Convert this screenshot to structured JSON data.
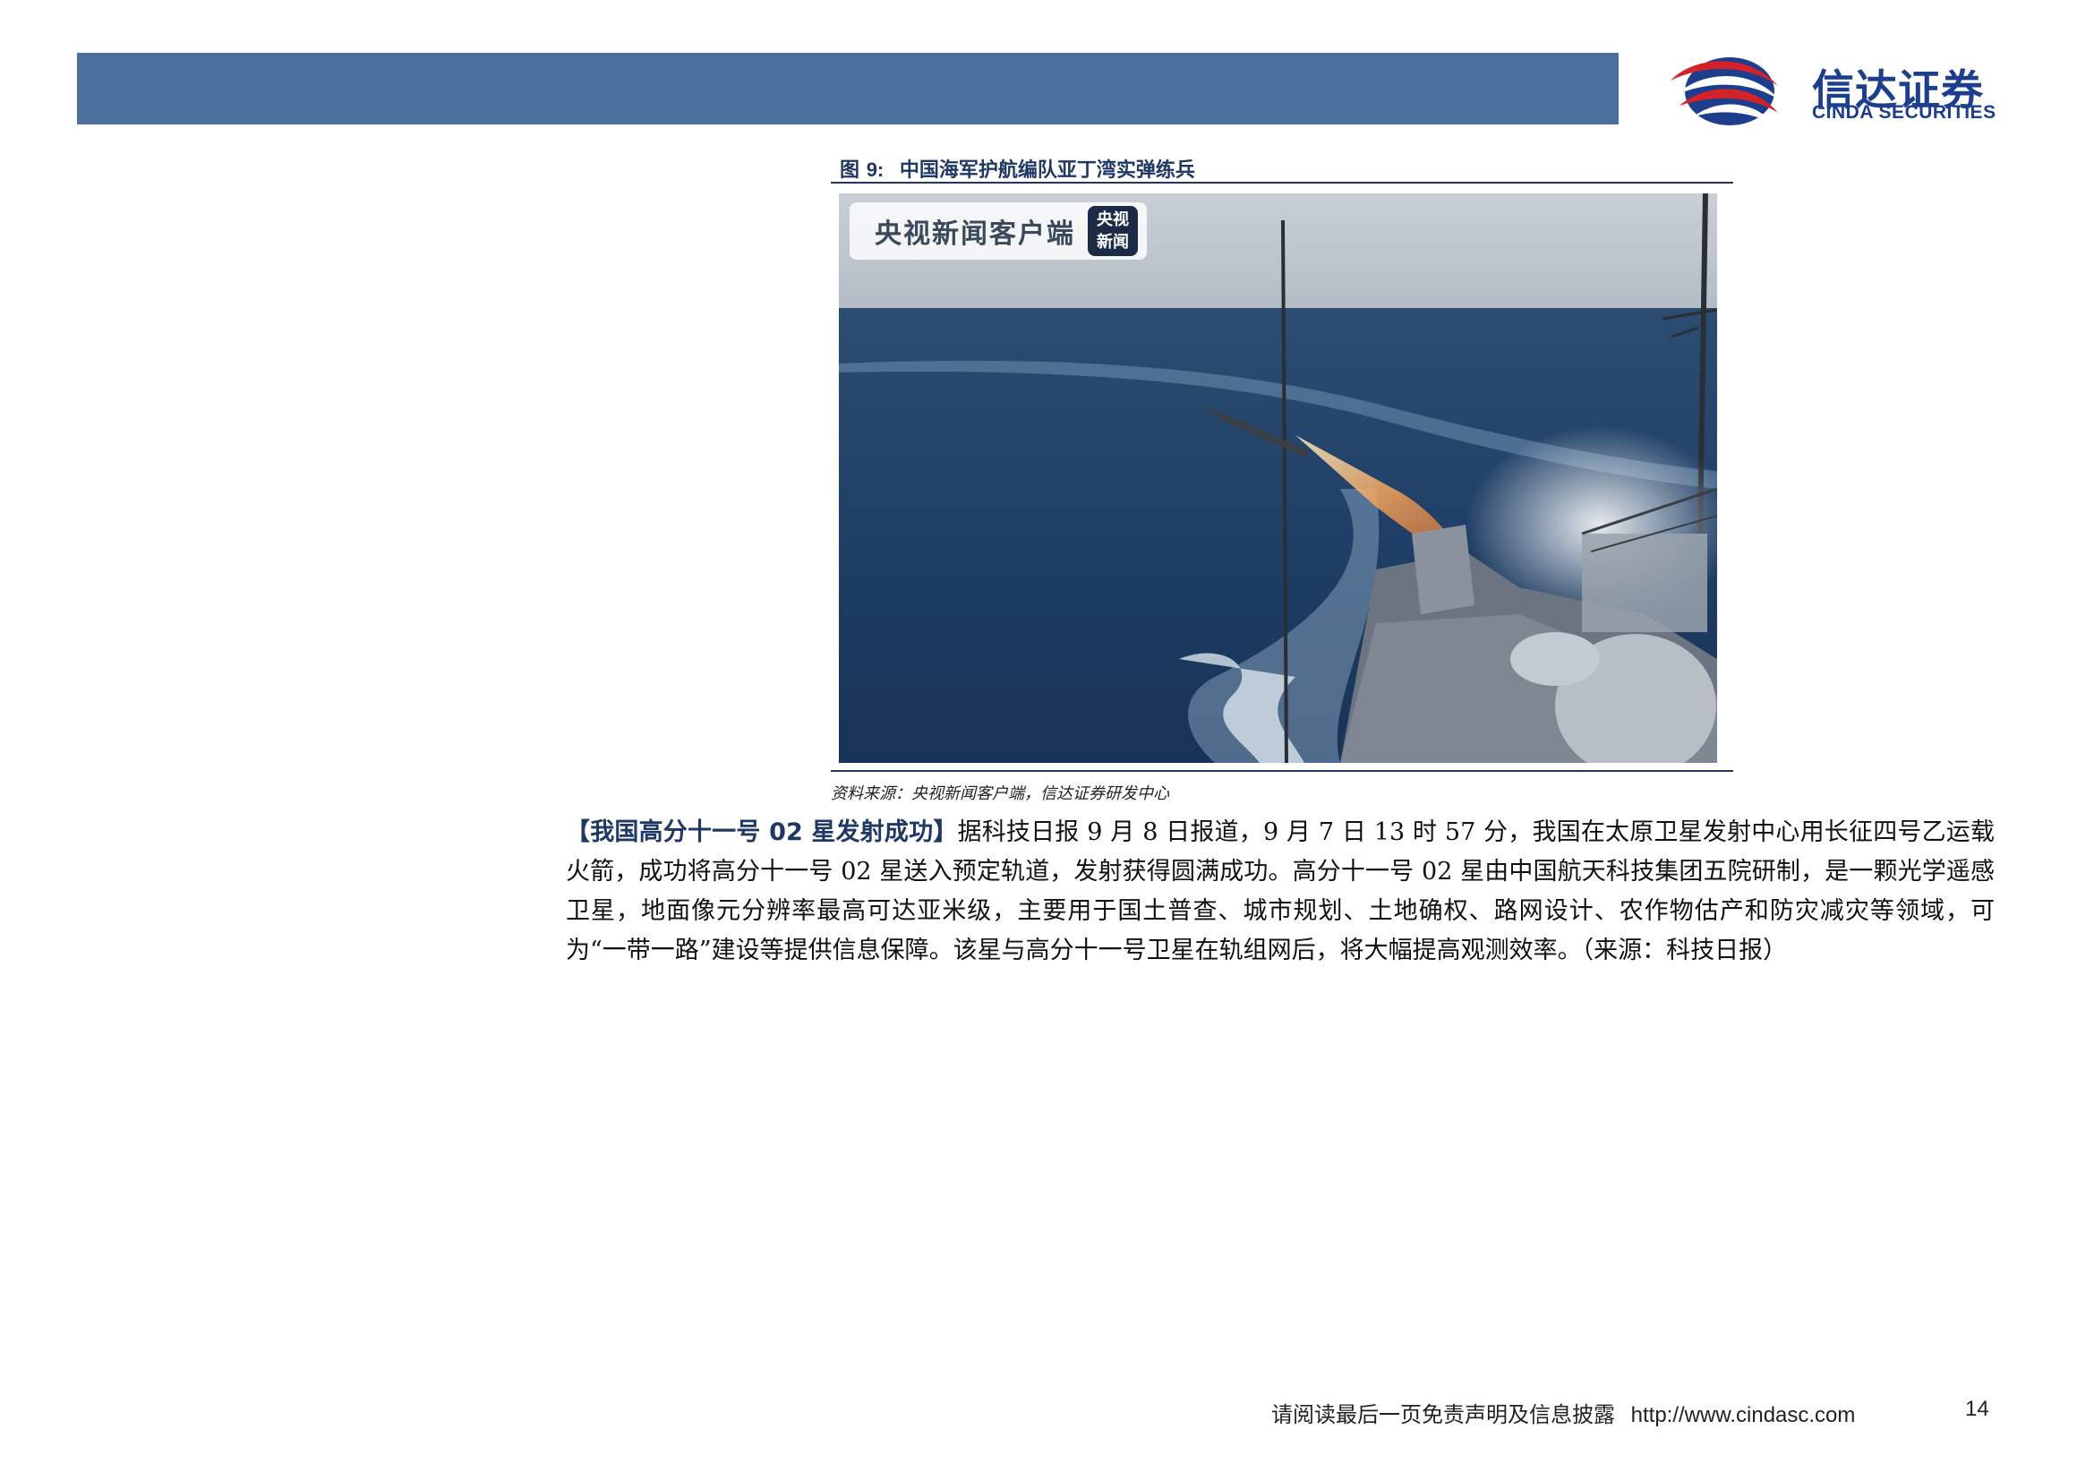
{
  "header": {
    "logo_cn": "信达证券",
    "logo_en": "CINDA SECURITIES",
    "colors": {
      "bar": "#4a6f9b",
      "logo_red": "#d3222a",
      "logo_blue": "#1d3e8c"
    }
  },
  "figure": {
    "caption_prefix": "图",
    "caption_num": "9:",
    "caption_text": "中国海军护航编队亚丁湾实弹练兵",
    "photo_watermark": "央视新闻客户端",
    "photo_badge_line1": "央视",
    "photo_badge_line2": "新闻",
    "source": "资料来源：央视新闻客户端，信达证券研发中心"
  },
  "article": {
    "lead": "【我国高分十一号 02 星发射成功】",
    "body": "据科技日报 9 月 8 日报道，9 月 7 日 13 时 57 分，我国在太原卫星发射中心用长征四号乙运载火箭，成功将高分十一号 02 星送入预定轨道，发射获得圆满成功。高分十一号 02 星由中国航天科技集团五院研制，是一颗光学遥感卫星，地面像元分辨率最高可达亚米级，主要用于国土普查、城市规划、土地确权、路网设计、农作物估产和防灾减灾等领域，可为“一带一路”建设等提供信息保障。该星与高分十一号卫星在轨组网后，将大幅提高观测效率。（来源：科技日报）"
  },
  "footer": {
    "disclaimer": "请阅读最后一页免责声明及信息披露",
    "url": "http://www.cindasc.com",
    "page": "14"
  }
}
